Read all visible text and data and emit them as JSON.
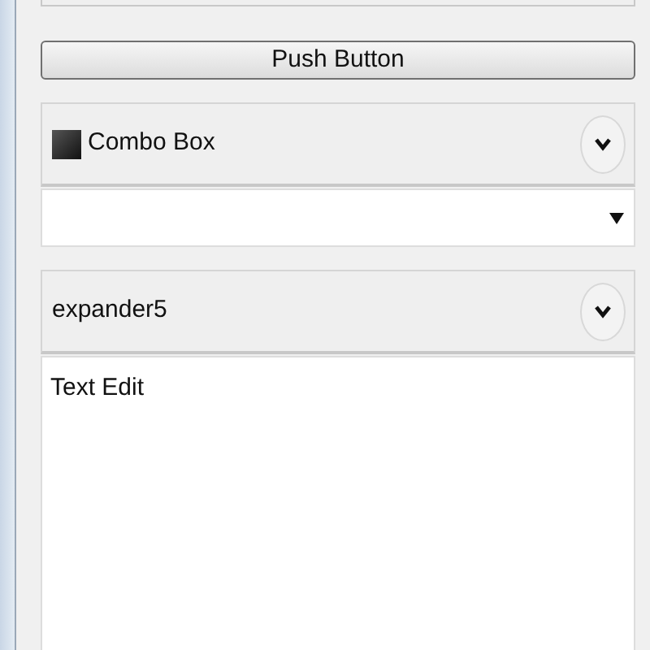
{
  "push_button": {
    "label": "Push Button"
  },
  "expanders": [
    {
      "kind": "combo",
      "title": "Combo Box",
      "has_icon": true,
      "expanded": true
    },
    {
      "kind": "text_edit",
      "title": "expander5",
      "has_icon": false,
      "expanded": true,
      "value": "Text Edit"
    }
  ]
}
